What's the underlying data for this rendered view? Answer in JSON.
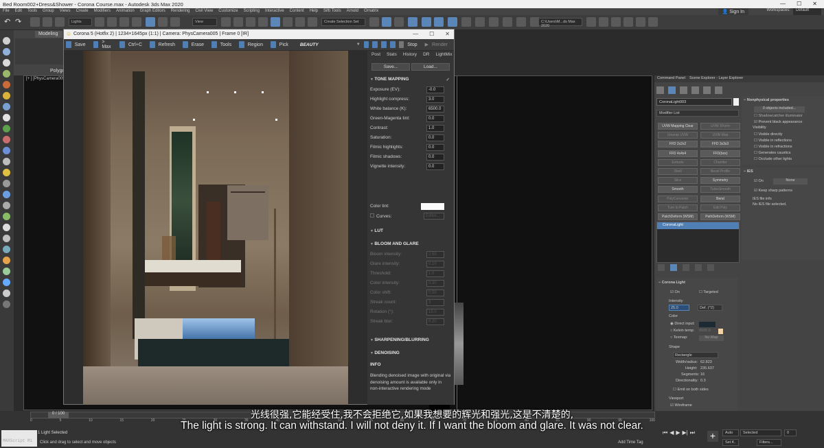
{
  "window": {
    "title": "Bed Room002+Dress&Shower - Corona Course.max - Autodesk 3ds Max 2020",
    "signin": "Sign In",
    "workspaces_label": "Workspaces:",
    "workspaces_value": "Default"
  },
  "menu": [
    "File",
    "Edit",
    "Tools",
    "Group",
    "Views",
    "Create",
    "Modifiers",
    "Animation",
    "Graph Editors",
    "Rendering",
    "Civil View",
    "Customize",
    "Scripting",
    "Interactive",
    "Content",
    "Help",
    "Sifti Tools",
    "Arnold",
    "Ornatrix"
  ],
  "toolbar": {
    "layer_combo": "Lights",
    "view_combo": "View",
    "selection_set": "Create Selection Set",
    "path_combo": "C:\\Users\\M...ds Max 2020"
  },
  "ribbon": {
    "tab": "Modeling",
    "group": "Polygo"
  },
  "viewport": {
    "label": "[+ ] [PhysCamera005]"
  },
  "vfb": {
    "title": "Corona 5 (Hotfix 2) | 1234×1645px (1:1) | Camera: PhysCamera005 | Frame 0 [IR]",
    "toolbar": {
      "save": "Save",
      "max": "> Max",
      "ctrlc": "Ctrl+C",
      "refresh": "Refresh",
      "erase": "Erase",
      "tools": "Tools",
      "region": "Region",
      "pick": "Pick",
      "beauty": "BEAUTY",
      "stop": "Stop",
      "render": "Render"
    },
    "tabs": [
      "Post",
      "Stats",
      "History",
      "DR",
      "LightMix"
    ],
    "save_btn": "Save...",
    "load_btn": "Load...",
    "tone_mapping": {
      "title": "TONE MAPPING",
      "rows": [
        {
          "label": "Exposure (EV):",
          "value": "-0.0"
        },
        {
          "label": "Highlight compress:",
          "value": "3.0"
        },
        {
          "label": "White balance (K):",
          "value": "6500.0"
        },
        {
          "label": "Green-Magenta tint:",
          "value": "0.0"
        },
        {
          "label": "Contrast:",
          "value": "1.0"
        },
        {
          "label": "Saturation:",
          "value": "0.0"
        },
        {
          "label": "Filmic highlights:",
          "value": "0.0"
        },
        {
          "label": "Filmic shadows:",
          "value": "0.0"
        },
        {
          "label": "Vignette intensity:",
          "value": "0.0"
        }
      ],
      "color_tint": "Color tint:",
      "curves": "Curves:",
      "editor": "Editor..."
    },
    "lut": "LUT",
    "bloom": {
      "title": "BLOOM AND GLARE",
      "rows": [
        {
          "label": "Bloom intensity:",
          "value": "2.50"
        },
        {
          "label": "Glare intensity:",
          "value": "0.10"
        },
        {
          "label": "Threshold:",
          "value": "1.0"
        },
        {
          "label": "Color intensity:",
          "value": "0.30"
        },
        {
          "label": "Color shift:",
          "value": "0.50"
        },
        {
          "label": "Streak count:",
          "value": "3"
        },
        {
          "label": "Rotation (°):",
          "value": "15.0"
        },
        {
          "label": "Streak blur:",
          "value": "0.20"
        }
      ]
    },
    "sharpening": "SHARPENING/BLURRING",
    "denoising": "DENOISING",
    "info_title": "INFO",
    "info_text": "Blending denoised image with original via denoising amount is available only in non-interactive rendering mode"
  },
  "command_panel": {
    "tabs": [
      "Command Panel",
      "Scene Explorer - Layer Explorer"
    ],
    "object_name": "CoronaLight003",
    "modifier_list": "Modifier List",
    "buttons": [
      {
        "label": "UVW Mapping Clear",
        "dim": false
      },
      {
        "label": "UVW XForm",
        "dim": true
      },
      {
        "label": "Unwrap UVW",
        "dim": true
      },
      {
        "label": "UVW Map",
        "dim": true
      },
      {
        "label": "FFD 2x2x2",
        "dim": false
      },
      {
        "label": "FFD 3x3x3",
        "dim": false
      },
      {
        "label": "FFD 4x4x4",
        "dim": false
      },
      {
        "label": "FFD(box)",
        "dim": false
      },
      {
        "label": "Extrude",
        "dim": true
      },
      {
        "label": "Chamfer",
        "dim": true
      },
      {
        "label": "Shell",
        "dim": true
      },
      {
        "label": "Bevel Profile",
        "dim": true
      },
      {
        "label": "Slice",
        "dim": true
      },
      {
        "label": "Symmetry",
        "dim": false
      },
      {
        "label": "Smooth",
        "dim": false
      },
      {
        "label": "TurboSmooth",
        "dim": true
      },
      {
        "label": "PolyConverter",
        "dim": true
      },
      {
        "label": "Bend",
        "dim": false
      },
      {
        "label": "Turn to Patch",
        "dim": true
      },
      {
        "label": "Edit Poly",
        "dim": true
      },
      {
        "label": "PatchDeform (WSM)",
        "dim": false
      },
      {
        "label": "PathDeform (WSM)",
        "dim": false
      }
    ],
    "stack_item": "CoronaLight",
    "nonphysical": {
      "title": "Nonphysical properties",
      "objects_included": "0 objects included...",
      "shadowcatcher": "Shadowcatcher illuminator",
      "prevent_black": "Prevent black appearance",
      "visibility": "Visibility",
      "vis_items": [
        "Visible directly",
        "Visible in reflections",
        "Visible in refractions",
        "Generates caustics",
        "Occlude other lights"
      ]
    },
    "ies": {
      "title": "IES",
      "on": "On",
      "none": "None",
      "keep_sharp": "Keep sharp patterns",
      "file_info": "IES file info",
      "no_file": "No IES file selected."
    },
    "corona_light": {
      "title": "Corona Light",
      "on": "On",
      "targeted": "Targeted",
      "intensity_label": "Intensity",
      "intensity": "25.0",
      "unit": "Def. (^2)",
      "color_label": "Color",
      "direct_input": "Direct input:",
      "kelvin": "Kelvin temp:",
      "kelvin_val": "6500.0",
      "texmap": "Texmap:",
      "no_map": "No Map",
      "shape_label": "Shape",
      "shape": "Rectangle",
      "width_label": "Width/radius:",
      "width": "62.823",
      "height_label": "Height:",
      "height": "235.637",
      "segments_label": "Segments:",
      "segments": "16",
      "directionality_label": "Directionality:",
      "directionality": "0.3",
      "emit_both": "Emit on both sides",
      "viewport_label": "Viewport",
      "wireframe": "Wireframe"
    }
  },
  "timeline": {
    "frame": "0 / 100",
    "ticks": [
      "0",
      "5",
      "10",
      "15",
      "20",
      "25",
      "30",
      "35",
      "40",
      "45",
      "50",
      "55",
      "60",
      "65",
      "70",
      "75",
      "80",
      "85",
      "90",
      "95",
      "100"
    ],
    "status1": "1 Light Selected",
    "status2": "Click and drag to select and move objects",
    "maxscript": "MAXScript Mi",
    "add_time_tag": "Add Time Tag",
    "auto": "Auto",
    "selected": "Selected",
    "set_k": "Set K.",
    "filters": "Filters...",
    "frame_field": "0"
  },
  "subtitles": {
    "zh": "光线很强,它能经受住,我不会拒绝它,如果我想要的辉光和强光,这是不清楚的,",
    "en": "The light is strong. It can withstand. I will not deny it. If I want the bloom and glare. It was not clear."
  }
}
